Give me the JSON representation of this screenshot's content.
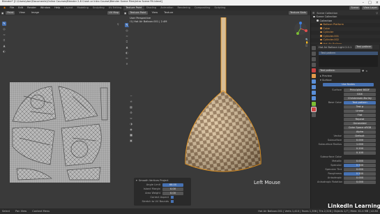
{
  "window": {
    "title": "Blender* [C:\\Users\\darr\\Documents\\Online Courses\\Blender 2.8 Crash or Intro Course\\Blender Scene Files\\Intro Scene Fill.blend]"
  },
  "menu": [
    "File",
    "Edit",
    "Render",
    "Window",
    "Help"
  ],
  "workspaces": [
    "Layout",
    "Modeling",
    "Sculpting",
    "UV Editing",
    "Texture Paint",
    "Shading",
    "Animation",
    "Rendering",
    "Compositing",
    "Scripting"
  ],
  "active_workspace": "Texture Paint",
  "scene": {
    "name": "Scene",
    "view_layer": "View Layer"
  },
  "image_editor": {
    "mode": "Paint",
    "menus": [
      "View",
      "Image"
    ],
    "image_name": "UV Map"
  },
  "viewport": {
    "mode": "Texture Paint",
    "menus": [
      "View",
      "Texture"
    ],
    "shading_label": "Texture Slots",
    "info_line1": "User Perspective",
    "info_line2": "(1) Hot Air Balloon.001 | 2.4M",
    "overlay_text": "Left Mouse"
  },
  "redo_panel": {
    "title": "Smooth Vertices Project",
    "fields": [
      {
        "label": "Angle Limit",
        "value": "66.00"
      },
      {
        "label": "Island Margin",
        "value": "0.00"
      },
      {
        "label": "Area Weight",
        "value": "0.00"
      }
    ],
    "checks": [
      {
        "label": "Correct Aspect",
        "checked": true
      },
      {
        "label": "Stretch to UV Bounds",
        "checked": true
      }
    ]
  },
  "outliner": {
    "header": "Scene Collection",
    "items": [
      {
        "label": "Scene Collection",
        "depth": 0,
        "color": "#cfcfcf"
      },
      {
        "label": "Collection",
        "depth": 1,
        "color": "#cfcfcf"
      },
      {
        "label": "Balloon Platform",
        "depth": 2,
        "color": "#e39a4a"
      },
      {
        "label": "Cube",
        "depth": 2,
        "color": "#e39a4a"
      },
      {
        "label": "Cylinder",
        "depth": 2,
        "color": "#e39a4a"
      },
      {
        "label": "Cylinder.001",
        "depth": 2,
        "color": "#e39a4a"
      },
      {
        "label": "Cylinder.002",
        "depth": 2,
        "color": "#e39a4a"
      },
      {
        "label": "Hot Air Balloon",
        "depth": 2,
        "color": "#e39a4a"
      }
    ]
  },
  "properties": {
    "object_name": "Hot Air Balloon Light 2.0.1",
    "material": "Test pattern",
    "material_slot": "Test pattern",
    "section_preview": "Preview",
    "section_surface": "Surface",
    "use_nodes": "Use Nodes",
    "fields": [
      {
        "label": "Surface",
        "value": "Principled BSDF"
      },
      {
        "label": "",
        "value": "GGX"
      },
      {
        "label": "",
        "value": "Christensen-Burley"
      },
      {
        "label": "Base Color",
        "value": "Test pattern",
        "highlight": true
      },
      {
        "label": "",
        "value": "Test p"
      },
      {
        "label": "",
        "value": "Linear"
      },
      {
        "label": "",
        "value": "Flat"
      },
      {
        "label": "",
        "value": "Repeat"
      },
      {
        "label": "",
        "value": "Generated"
      },
      {
        "label": "",
        "value": "Color Space sRGB"
      },
      {
        "label": "",
        "value": "Alpha"
      },
      {
        "label": "Vector",
        "value": "Default"
      },
      {
        "label": "Subsurface",
        "value": "0.000"
      },
      {
        "label": "Subsurface Radius",
        "value": "1.000"
      },
      {
        "label": "",
        "value": "0.200"
      },
      {
        "label": "",
        "value": "0.100"
      },
      {
        "label": "Subsurface Color",
        "value": ""
      },
      {
        "label": "Metallic",
        "value": "0.000"
      },
      {
        "label": "Specular",
        "value": "0.500",
        "bar": 0.5
      },
      {
        "label": "Specular Tint",
        "value": "0.000"
      },
      {
        "label": "Roughness",
        "value": "0.500",
        "bar": 0.5
      },
      {
        "label": "Anisotropic",
        "value": "0.000"
      },
      {
        "label": "Anisotropic Rotation",
        "value": "0.000"
      }
    ]
  },
  "statusbar": {
    "left": [
      "Select",
      "Pan View",
      "Context Menu"
    ],
    "right": "Hot Air Balloon.001 | Verts 1,410 | Faces 1,356 | Tris 2,528 | Objects 1/7 | Mem: 61.4 MB | v2.80"
  },
  "watermark": "LinkedIn Learning",
  "colors": {
    "accent": "#4772b3",
    "selected_orange": "#f29c21",
    "balloon_light": "#dcc19a",
    "balloon_dark": "#8a6a48"
  }
}
